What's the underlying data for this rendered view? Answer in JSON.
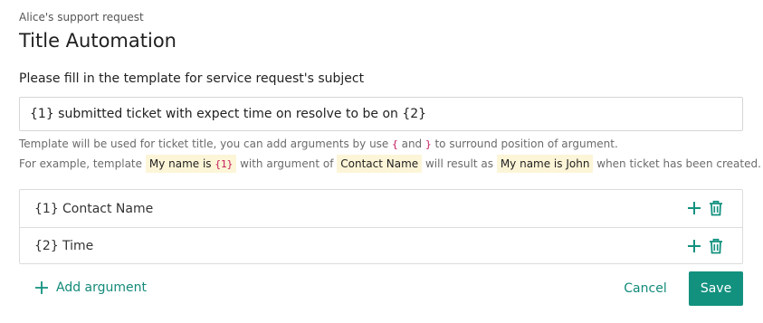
{
  "header": {
    "breadcrumb": "Alice's support request",
    "title": "Title Automation"
  },
  "form": {
    "label": "Please fill in the template for service request's subject",
    "template_value": "{1} submitted ticket with expect time on resolve to be on {2}"
  },
  "help": {
    "line1_prefix": "Template will be used for ticket title, you can add arguments by use",
    "open_brace": "{",
    "and_text": "and",
    "close_brace": "}",
    "line1_suffix": "to surround position of argument.",
    "line2_prefix": "For example, template",
    "example_template_text": "My name is",
    "example_template_code": "{1}",
    "with_arg_text": "with argument of",
    "example_argument": "Contact Name",
    "will_result_text": "will result as",
    "example_result": "My name is John",
    "line2_suffix": "when ticket has been created."
  },
  "arguments": [
    {
      "index": "{1}",
      "name": "Contact Name"
    },
    {
      "index": "{2}",
      "name": "Time"
    }
  ],
  "actions": {
    "add_argument": "Add argument",
    "cancel": "Cancel",
    "save": "Save"
  },
  "icons": {
    "add": "plus-icon",
    "delete": "trash-icon"
  },
  "colors": {
    "accent": "#13917f",
    "highlight": "#fdf5d8",
    "code": "#c2185b"
  }
}
